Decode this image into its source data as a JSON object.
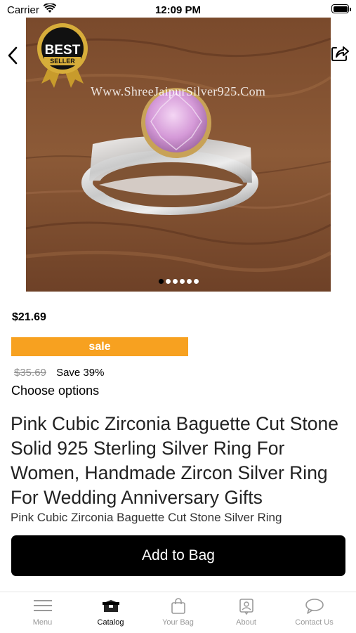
{
  "status_bar": {
    "carrier": "Carrier",
    "time": "12:09 PM"
  },
  "icons": {
    "back": "chevron-left-icon",
    "share": "share-icon",
    "wifi": "wifi-icon",
    "battery": "battery-icon"
  },
  "product": {
    "image": {
      "watermark": "Www.ShreeJaipurSilver925.Com",
      "badge_line1": "BEST",
      "badge_line2": "SELLER",
      "slide_count": 6,
      "active_slide": 1
    },
    "price": "$21.69",
    "sale_label": "sale",
    "old_price": "$35.69",
    "save_text": "Save 39%",
    "choose_options": "Choose options",
    "title": "Pink Cubic Zirconia Baguette Cut Stone Solid 925 Sterling Silver Ring For Women, Handmade Zircon Silver Ring For Wedding Anniversary Gifts",
    "subtitle": "Pink Cubic Zirconia Baguette Cut Stone Silver Ring",
    "add_to_bag": "Add to Bag"
  },
  "colors": {
    "sale": "#f7a120",
    "button": "#000000",
    "tab_inactive": "#9a9a9a"
  },
  "tabbar": {
    "items": [
      {
        "label": "Menu",
        "icon": "menu-icon"
      },
      {
        "label": "Catalog",
        "icon": "catalog-icon",
        "active": true
      },
      {
        "label": "Your Bag",
        "icon": "bag-icon"
      },
      {
        "label": "About",
        "icon": "about-icon"
      },
      {
        "label": "Contact Us",
        "icon": "chat-icon"
      }
    ]
  }
}
